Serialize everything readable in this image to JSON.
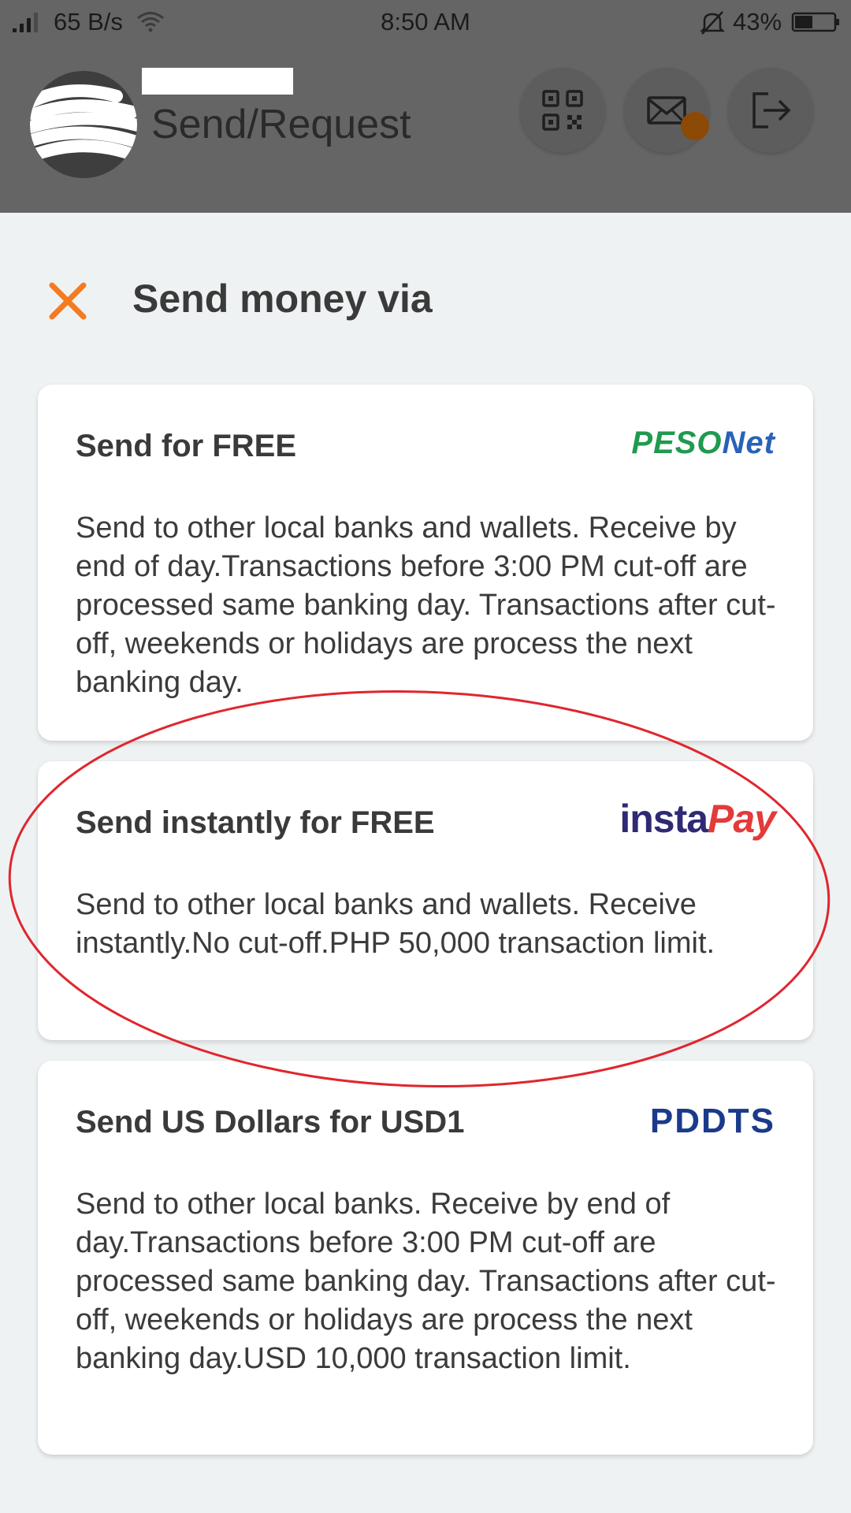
{
  "status_bar": {
    "network_speed": "65 B/s",
    "time": "8:50 AM",
    "battery": "43%"
  },
  "header": {
    "title": "Send/Request"
  },
  "sheet": {
    "title": "Send money via"
  },
  "options": [
    {
      "title": "Send for FREE",
      "logo": "PESONet",
      "logo_parts": [
        "PESO",
        "Net"
      ],
      "description": "Send to other local banks and wallets. Receive by end of day.Transactions before 3:00 PM cut-off are processed same banking day. Transactions after cut-off, weekends or holidays are process the next banking day."
    },
    {
      "title": "Send instantly for FREE",
      "logo": "instaPay",
      "logo_parts": [
        "insta",
        "Pay"
      ],
      "description": "Send to other local banks and wallets. Receive instantly.No cut-off.PHP 50,000 transaction limit."
    },
    {
      "title": "Send US Dollars for USD1",
      "logo": "PDDTS",
      "description": "Send to other local banks. Receive by end of day.Transactions before 3:00 PM cut-off are processed same banking day. Transactions after cut-off, weekends or holidays are process the next banking day.USD 10,000 transaction limit."
    }
  ],
  "colors": {
    "accent": "#f47b20",
    "overlay": "#656565",
    "background": "#eff2f3",
    "highlight_circle": "#e0262e"
  }
}
